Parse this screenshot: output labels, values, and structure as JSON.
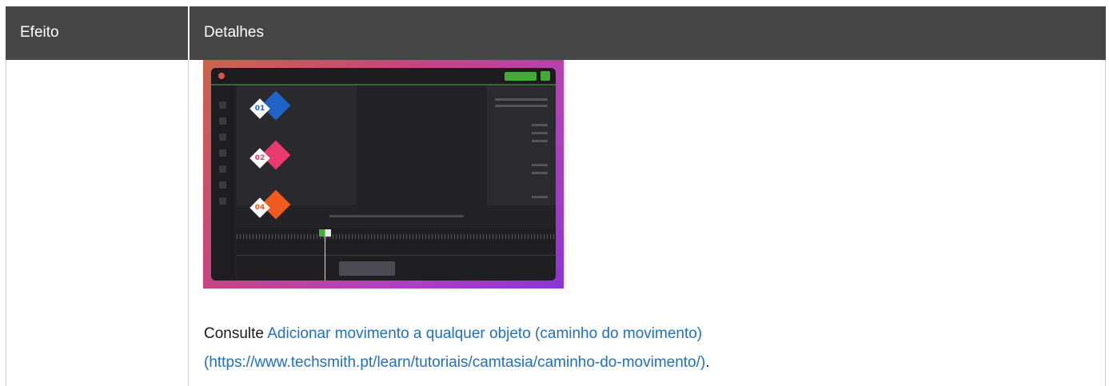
{
  "table": {
    "headers": {
      "effect": "Efeito",
      "details": "Detalhes"
    },
    "row": {
      "effect": "",
      "illustration": {
        "description_icon": "camtasia-motion-path-screenshot",
        "badges": [
          "01",
          "02",
          "04"
        ],
        "badge_colors": [
          "#1f63c6",
          "#e83a6c",
          "#f05a1e"
        ]
      },
      "text_prefix": "Consulte ",
      "link_text": "Adicionar movimento a qualquer objeto (caminho do movimento)",
      "link_url_text": "(https://www.techsmith.pt/learn/tutoriais/camtasia/caminho-do-movimento/)",
      "text_suffix": "."
    }
  },
  "colors": {
    "header_bg": "#464646",
    "link": "#1f6fc5"
  }
}
